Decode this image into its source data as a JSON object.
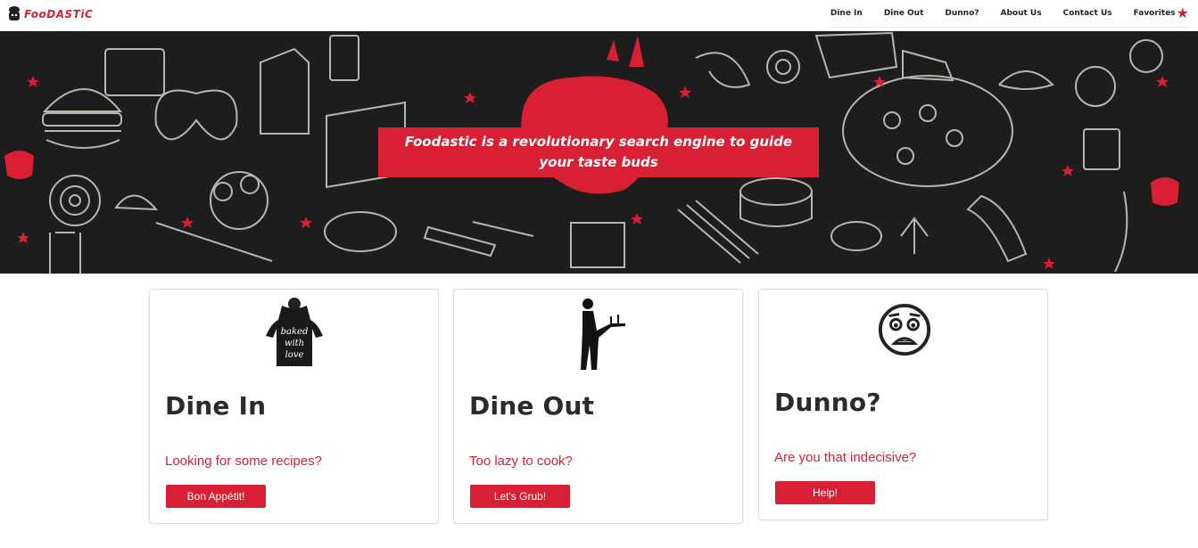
{
  "brand": {
    "name": "FooDASTiC"
  },
  "nav": {
    "links": [
      "Dine In",
      "Dine Out",
      "Dunno?",
      "About Us",
      "Contact Us",
      "Favorites"
    ],
    "favorites_icon": "star-icon"
  },
  "hero": {
    "tagline": "Foodastic is a revolutionary search engine to guide your taste buds"
  },
  "cards": [
    {
      "title": "Dine In",
      "text": "Looking for some recipes?",
      "button": "Bon Appétit!",
      "icon": "apron-icon",
      "icon_text": [
        "baked",
        "with",
        "love"
      ]
    },
    {
      "title": "Dine Out",
      "text": "Too lazy to cook?",
      "button": "Let's Grub!",
      "icon": "waiter-icon"
    },
    {
      "title": "Dunno?",
      "text": "Are you that indecisive?",
      "button": "Help!",
      "icon": "worried-face-icon"
    }
  ],
  "colors": {
    "accent": "#d81f33",
    "hero_bg": "#1d1d1d",
    "heading": "#2b2b2b"
  }
}
